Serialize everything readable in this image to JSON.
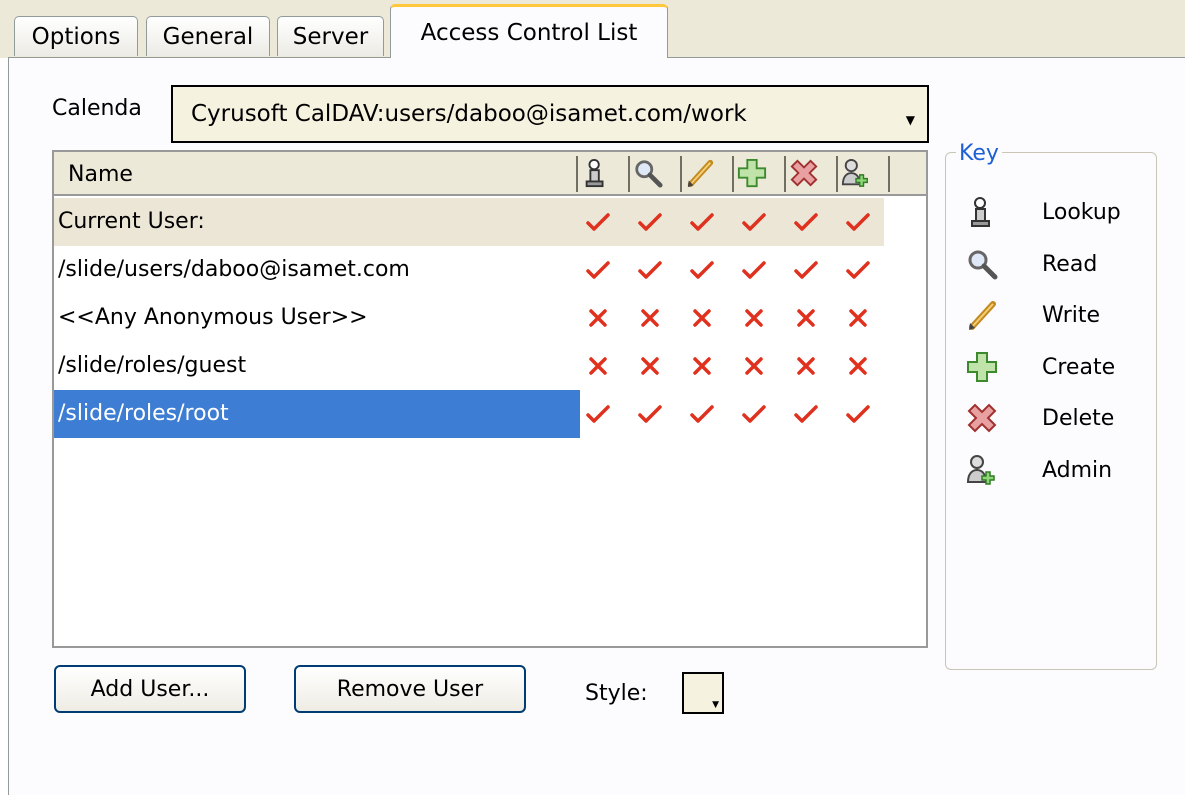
{
  "tabs": [
    {
      "label": "Options"
    },
    {
      "label": "General"
    },
    {
      "label": "Server"
    },
    {
      "label": "Access Control List"
    }
  ],
  "calendar": {
    "label": "Calenda",
    "value": "Cyrusoft CalDAV:users/daboo@isamet.com/work"
  },
  "table": {
    "header_name": "Name",
    "columns": [
      "lookup-icon",
      "read-icon",
      "write-icon",
      "create-icon",
      "delete-icon",
      "admin-icon"
    ],
    "rows": [
      {
        "name": "Current User:",
        "rights": [
          "check",
          "check",
          "check",
          "check",
          "check",
          "check"
        ]
      },
      {
        "name": "/slide/users/daboo@isamet.com",
        "rights": [
          "check",
          "check",
          "check",
          "check",
          "check",
          "check"
        ]
      },
      {
        "name": "<<Any Anonymous User>>",
        "rights": [
          "cross",
          "cross",
          "cross",
          "cross",
          "cross",
          "cross"
        ]
      },
      {
        "name": "/slide/roles/guest",
        "rights": [
          "cross",
          "cross",
          "cross",
          "cross",
          "cross",
          "cross"
        ]
      },
      {
        "name": "/slide/roles/root",
        "rights": [
          "check",
          "check",
          "check",
          "check",
          "check",
          "check"
        ]
      }
    ],
    "selected_row": 4
  },
  "key": {
    "title": "Key",
    "items": [
      {
        "icon": "lookup-icon",
        "label": "Lookup"
      },
      {
        "icon": "read-icon",
        "label": "Read"
      },
      {
        "icon": "write-icon",
        "label": "Write"
      },
      {
        "icon": "create-icon",
        "label": "Create"
      },
      {
        "icon": "delete-icon",
        "label": "Delete"
      },
      {
        "icon": "admin-icon",
        "label": "Admin"
      }
    ]
  },
  "buttons": {
    "add_user": "Add User...",
    "remove_user": "Remove User"
  },
  "style": {
    "label": "Style:"
  },
  "colors": {
    "check": "#e0301e",
    "selection": "#3d7ed4",
    "key_title": "#1d5fd6",
    "active_tab_accent": "#ffc83c"
  }
}
